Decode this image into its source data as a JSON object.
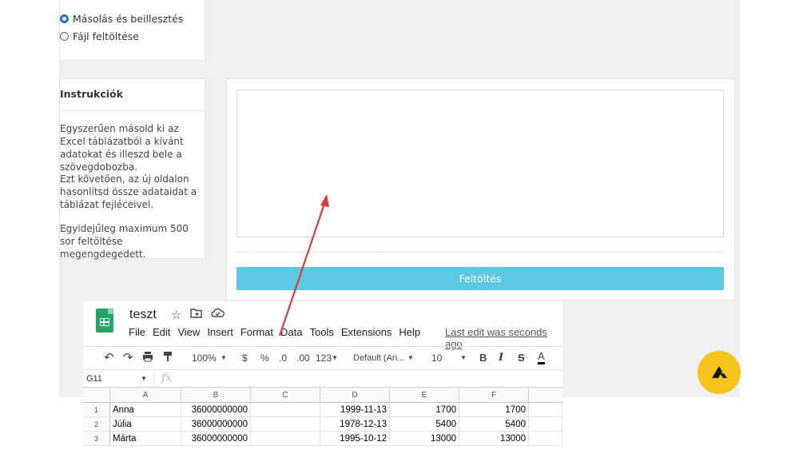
{
  "options": {
    "copy_paste": "Másolás és beillesztés",
    "file_upload": "Fájl feltöltése",
    "selected": "copy_paste"
  },
  "instructions": {
    "title": "Instrukciók",
    "p1": "Egyszerűen másold ki az Excel táblázatból a kívánt adatokat és illeszd bele a szövegdobozba.",
    "p2": "Ezt követően, az új oldalon hasonlítsd össze adataidat a táblázat fejléceivel.",
    "p3": "Egyidejűleg maximum 500 sor feltöltése megengdegedett."
  },
  "upload_button": "Feltöltés",
  "sheet": {
    "title": "teszt",
    "menu": [
      "File",
      "Edit",
      "View",
      "Insert",
      "Format",
      "Data",
      "Tools",
      "Extensions",
      "Help"
    ],
    "last_edit": "Last edit was seconds ago",
    "toolbar": {
      "zoom": "100%",
      "currency": "$",
      "percent": "%",
      "dec_decrease": ".0",
      "dec_increase": ".00",
      "number_format": "123",
      "font": "Default (Ari...",
      "font_size": "10",
      "bold": "B",
      "italic": "I",
      "strike": "S",
      "text_color": "A"
    },
    "cell_ref": "G11",
    "fx": "fx",
    "columns": [
      "A",
      "B",
      "C",
      "D",
      "E",
      "F"
    ],
    "rows": [
      {
        "num": "1",
        "cells": [
          "Anna",
          "36000000000",
          "",
          "1999-11-13",
          "1700",
          "1700"
        ]
      },
      {
        "num": "2",
        "cells": [
          "Júlia",
          "36000000000",
          "",
          "1978-12-13",
          "5400",
          "5400"
        ]
      },
      {
        "num": "3",
        "cells": [
          "Márta",
          "36000000000",
          "",
          "1995-10-12",
          "13000",
          "13000"
        ]
      }
    ]
  },
  "colors": {
    "accent_radio": "#1a73e8",
    "upload_button": "#5bc8e2",
    "arrow": "#e53935",
    "badge": "#f5c51b",
    "sheets_green": "#23a566"
  }
}
